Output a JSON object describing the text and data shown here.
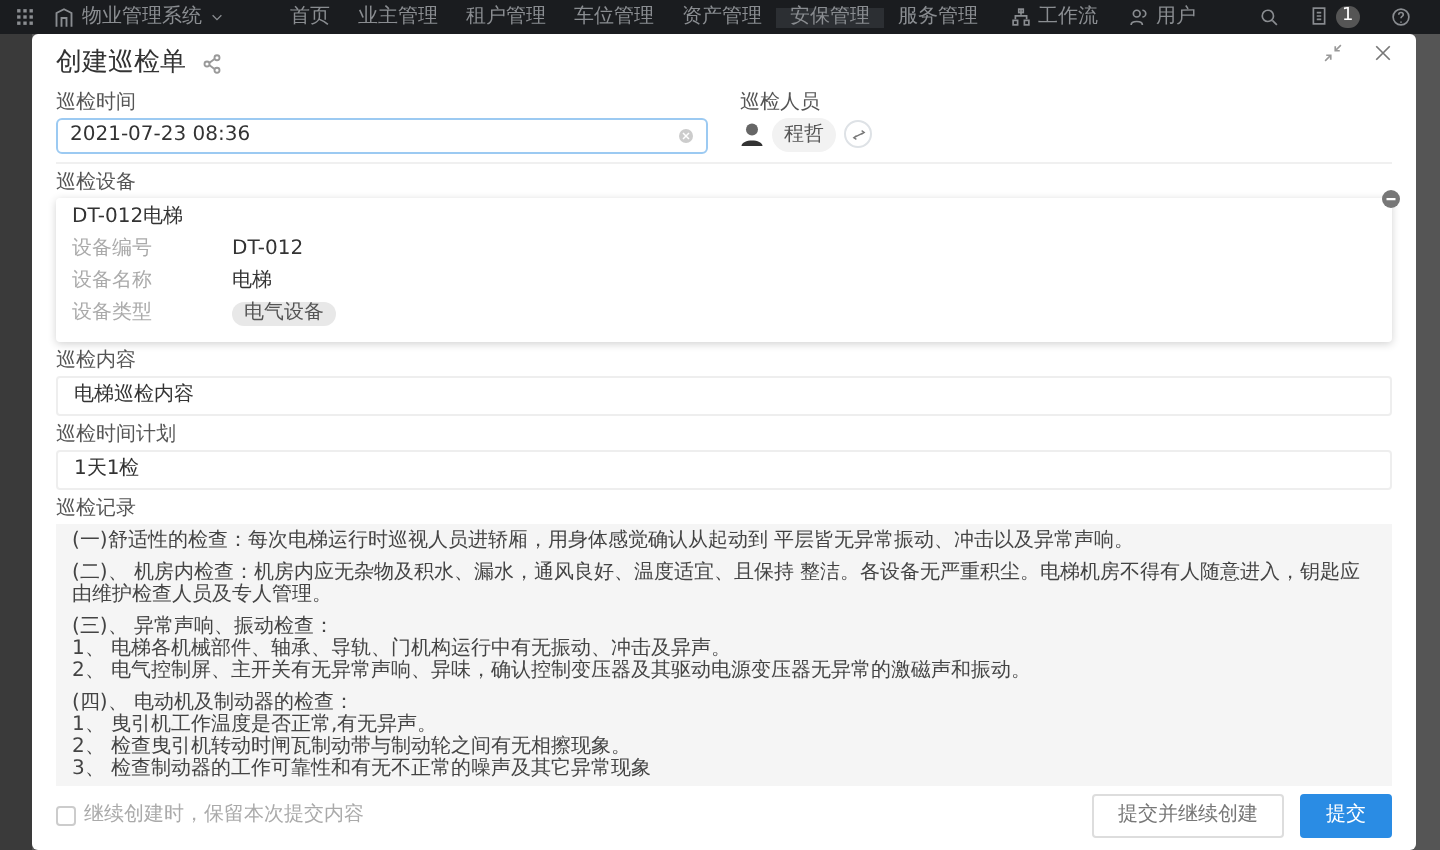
{
  "navbar": {
    "brand": "物业管理系统",
    "menu": [
      {
        "label": "首页",
        "selected": false
      },
      {
        "label": "业主管理",
        "selected": false
      },
      {
        "label": "租户管理",
        "selected": false
      },
      {
        "label": "车位管理",
        "selected": false
      },
      {
        "label": "资产管理",
        "selected": false
      },
      {
        "label": "安保管理",
        "selected": true
      },
      {
        "label": "服务管理",
        "selected": false
      }
    ],
    "workflow": "工作流",
    "user": "用户",
    "notification_count": "1"
  },
  "dialog": {
    "title": "创建巡检单",
    "time": {
      "label": "巡检时间",
      "value": "2021-07-23 08:36"
    },
    "inspector": {
      "label": "巡检人员",
      "name": "程哲"
    },
    "device": {
      "label": "巡检设备",
      "title": "DT-012电梯",
      "rows": [
        {
          "key": "设备编号",
          "value": "DT-012",
          "kind": "text"
        },
        {
          "key": "设备名称",
          "value": "电梯",
          "kind": "text"
        },
        {
          "key": "设备类型",
          "value": "电气设备",
          "kind": "tag"
        }
      ]
    },
    "content": {
      "label": "巡检内容",
      "value": "电梯巡检内容"
    },
    "plan": {
      "label": "巡检时间计划",
      "value": "1天1检"
    },
    "record": {
      "label": "巡检记录",
      "paragraphs": [
        [
          "(一)舒适性的检查：每次电梯运行时巡视人员进轿厢，用身体感觉确认从起动到 平层皆无异常振动、冲击以及异常声响。"
        ],
        [
          "(二)、 机房内检查：机房内应无杂物及积水、漏水，通风良好、温度适宜、且保持 整洁。各设备无严重积尘。电梯机房不得有人随意进入，钥匙应由维护检查人员及专人管理。"
        ],
        [
          "(三)、 异常声响、振动检查：",
          "1、 电梯各机械部件、轴承、导轨、门机构运行中有无振动、冲击及异声。",
          "2、 电气控制屏、主开关有无异常声响、异味，确认控制变压器及其驱动电源变压器无异常的激磁声和振动。"
        ],
        [
          "(四)、 电动机及制动器的检查：",
          "1、 曳引机工作温度是否正常,有无异声。",
          "2、 检查曳引机转动时闸瓦制动带与制动轮之间有无相擦现象。",
          "3、 检查制动器的工作可靠性和有无不正常的噪声及其它异常现象"
        ]
      ]
    },
    "keep_content": {
      "label": "继续创建时，保留本次提交内容",
      "checked": false
    },
    "buttons": [
      {
        "label": "提交并继续创建",
        "kind": "secondary"
      },
      {
        "label": "提交",
        "kind": "primary"
      }
    ]
  }
}
